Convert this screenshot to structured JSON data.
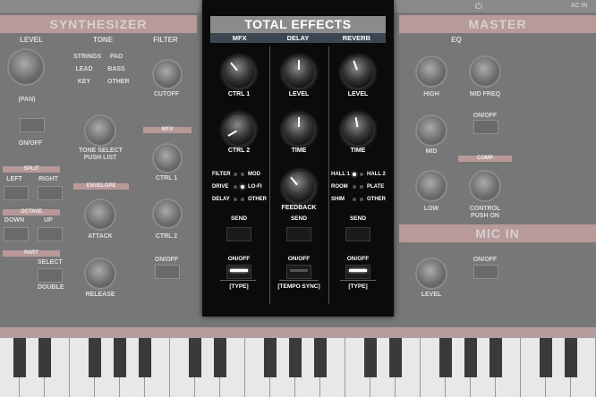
{
  "background": {
    "synth_title": "SYNTHESIZER",
    "master_title": "MASTER",
    "mic_title": "MIC IN",
    "level": "LEVEL",
    "tone": "TONE",
    "filter": "FILTER",
    "eq": "EQ",
    "pan": "(PAN)",
    "on_off": "ON/OFF",
    "split": "SPLIT",
    "left": "LEFT",
    "right": "RIGHT",
    "octave": "OCTAVE",
    "down": "DOWN",
    "up": "UP",
    "part": "PART",
    "select": "SELECT",
    "double": "DOUBLE",
    "strings": "STRINGS",
    "pad": "PAD",
    "lead": "LEAD",
    "bass": "BASS",
    "key": "KEY",
    "other": "OTHER",
    "tone_select": "TONE SELECT",
    "push_list": "PUSH LIST",
    "envelope": "ENVELOPE",
    "attack": "ATTACK",
    "release": "RELEASE",
    "cutoff": "CUTOFF",
    "mfx": "MFX",
    "ctrl1": "CTRL 1",
    "ctrl2": "CTRL 2",
    "high": "HIGH",
    "mid_freq": "MID FREQ",
    "mid": "MID",
    "low": "LOW",
    "comp": "COMP",
    "control": "CONTROL",
    "push_on": "PUSH ON",
    "ac_in": "AC IN"
  },
  "panel": {
    "title": "TOTAL EFFECTS",
    "tabs": [
      "MFX",
      "DELAY",
      "REVERB"
    ],
    "mfx": {
      "ctrl1": "CTRL 1",
      "ctrl2": "CTRL 2",
      "options": [
        {
          "left": "FILTER",
          "right": "MOD"
        },
        {
          "left": "DRIVE",
          "right": "LO-FI"
        },
        {
          "left": "DELAY",
          "right": "OTHER"
        }
      ],
      "send": "SEND",
      "on_off": "ON/OFF",
      "type": "[TYPE]"
    },
    "delay": {
      "level": "LEVEL",
      "time": "TIME",
      "feedback": "FEEDBACK",
      "send": "SEND",
      "on_off": "ON/OFF",
      "tempo_sync": "[TEMPO SYNC]"
    },
    "reverb": {
      "level": "LEVEL",
      "time": "TIME",
      "options": [
        {
          "left": "HALL 1",
          "right": "HALL 2"
        },
        {
          "left": "ROOM",
          "right": "PLATE"
        },
        {
          "left": "SHIM",
          "right": "OTHER"
        }
      ],
      "send": "SEND",
      "on_off": "ON/OFF",
      "type": "[TYPE]"
    }
  },
  "colors": {
    "panel_bg": "#0b0b0b",
    "title_bg": "#8b8b8b",
    "tab_bg": "#3a4652",
    "led_on": "#ffffff"
  }
}
